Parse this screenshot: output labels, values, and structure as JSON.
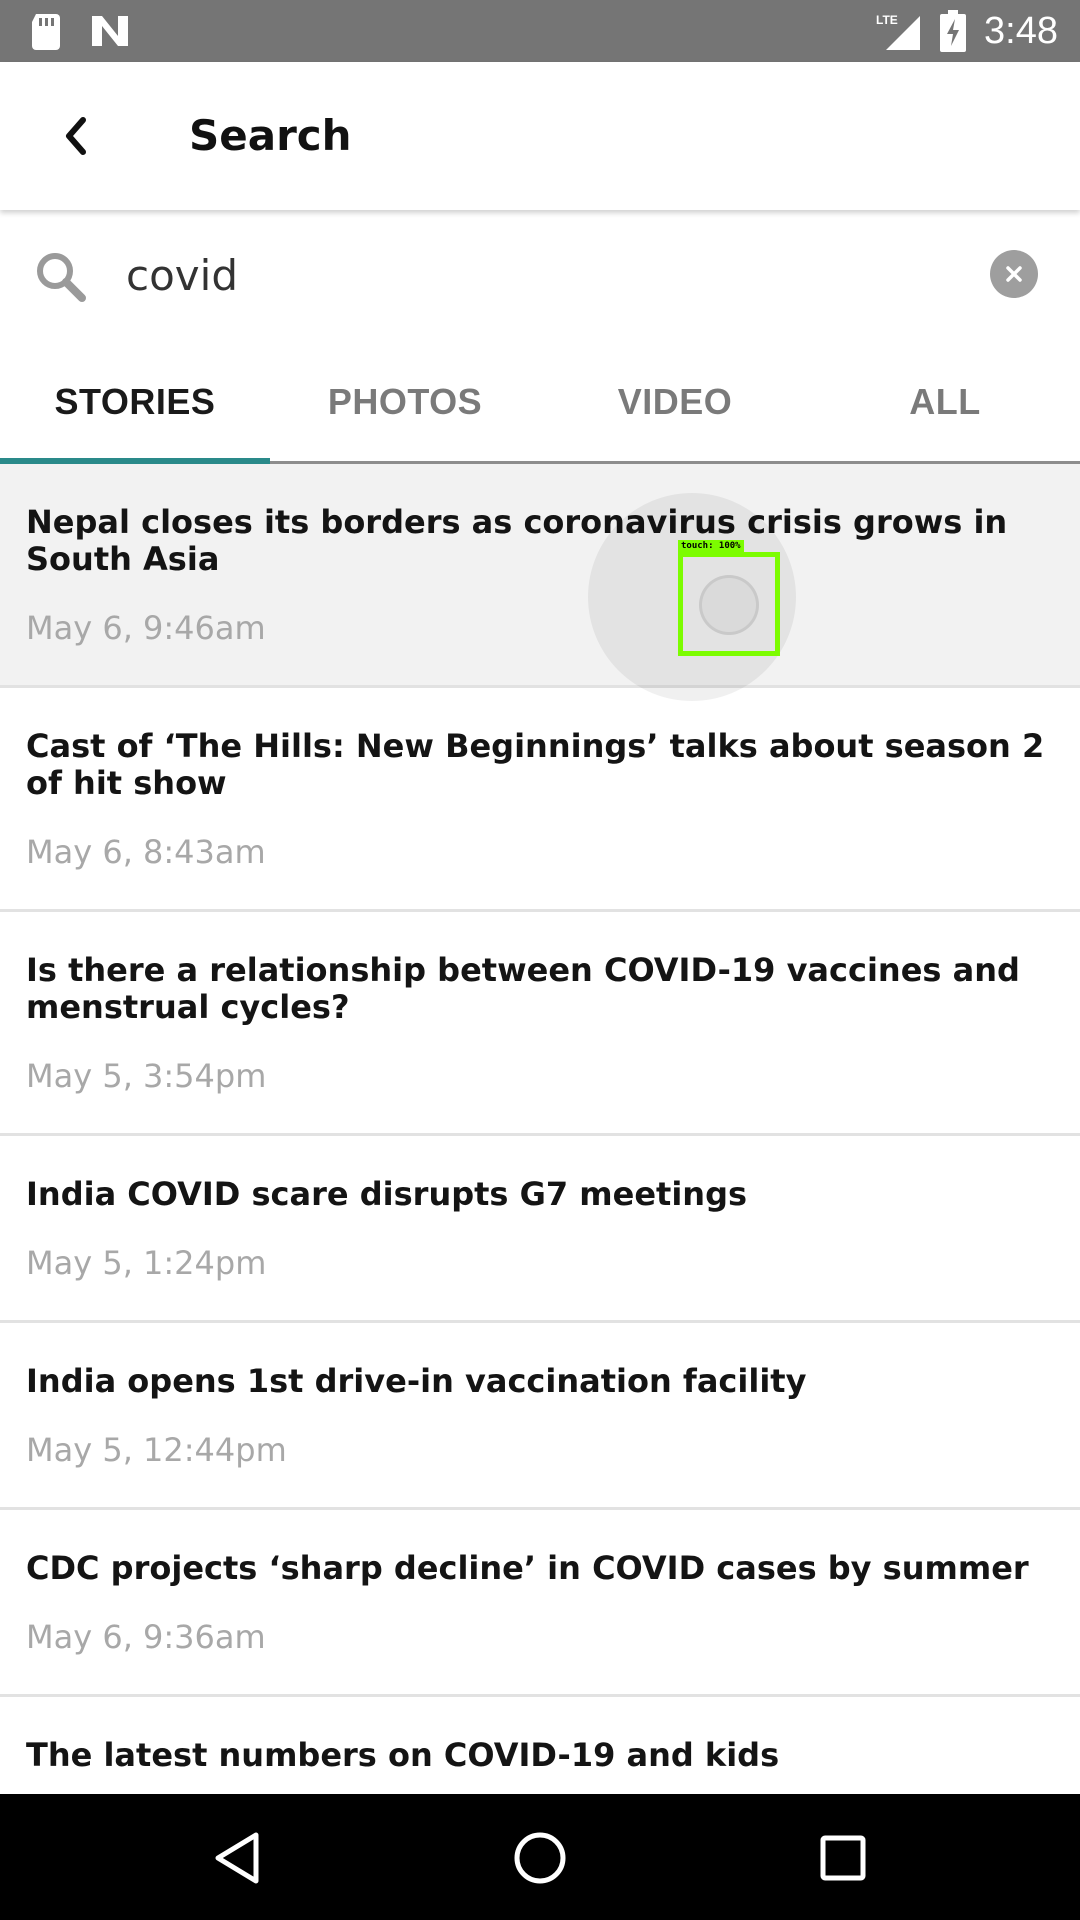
{
  "status_bar": {
    "time": "3:48",
    "network": "LTE",
    "icons": [
      "sd-card-icon",
      "n-notification-icon",
      "lte-signal-icon",
      "battery-charging-icon"
    ]
  },
  "app_bar": {
    "title": "Search",
    "back_icon": "chevron-left-icon"
  },
  "search": {
    "query": "covid",
    "search_icon": "search-icon",
    "clear_icon": "clear-icon"
  },
  "tabs": [
    {
      "label": "STORIES",
      "active": true
    },
    {
      "label": "PHOTOS",
      "active": false
    },
    {
      "label": "VIDEO",
      "active": false
    },
    {
      "label": "ALL",
      "active": false
    }
  ],
  "colors": {
    "status_bar": "#757575",
    "tab_indicator": "#2a8a8a",
    "headline": "#141414",
    "date": "#a8a8a8",
    "touch_box": "#7cfc00"
  },
  "stories": [
    {
      "headline": "Nepal closes its borders as coronavirus crisis grows in South Asia",
      "date": "May 6, 9:46am"
    },
    {
      "headline": "Cast of ‘The Hills: New Beginnings’ talks about season 2 of hit show",
      "date": "May 6, 8:43am"
    },
    {
      "headline": "Is there a relationship between COVID-19 vaccines and menstrual cycles?",
      "date": "May 5, 3:54pm"
    },
    {
      "headline": "India COVID scare disrupts G7 meetings",
      "date": "May 5, 1:24pm"
    },
    {
      "headline": "India opens 1st drive-in vaccination facility",
      "date": "May 5, 12:44pm"
    },
    {
      "headline": "CDC projects ‘sharp decline’ in COVID cases by summer",
      "date": "May 6, 9:36am"
    },
    {
      "headline": "The latest numbers on COVID-19 and kids",
      "date": ""
    }
  ],
  "touch_indicator": {
    "label": "touch: 100%"
  },
  "nav_bar": {
    "buttons": [
      "back-triangle-icon",
      "home-circle-icon",
      "recents-square-icon"
    ]
  }
}
